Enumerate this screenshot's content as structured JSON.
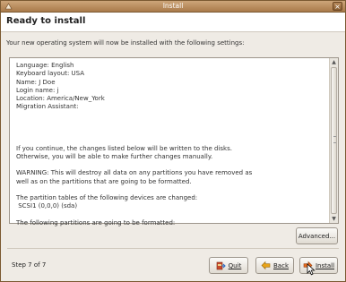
{
  "window": {
    "title": "Install"
  },
  "header": {
    "heading": "Ready to install"
  },
  "intro": "Your new operating system will now be installed with the following settings:",
  "settings_lines": [
    "Language: English",
    "Keyboard layout: USA",
    "Name: J Doe",
    "Login name: j",
    "Location: America/New_York",
    "Migration Assistant:"
  ],
  "notice_lines": [
    "If you continue, the changes listed below will be written to the disks.",
    "Otherwise, you will be able to make further changes manually."
  ],
  "warning_lines": [
    "WARNING: This will destroy all data on any partitions you have removed as",
    "well as on the partitions that are going to be formatted."
  ],
  "partition_lines": [
    "The partition tables of the following devices are changed:",
    " SCSI1 (0,0,0) (sda)"
  ],
  "format_line": "The following partitions are going to be formatted:",
  "buttons": {
    "advanced": "Advanced...",
    "quit": "Quit",
    "back": "Back",
    "install": "Install"
  },
  "footer": {
    "step": "Step 7 of 7"
  },
  "icons": {
    "app": "install-app-icon",
    "close": "close-icon",
    "quit": "quit-icon",
    "back": "back-arrow-icon",
    "install": "forward-arrow-icon",
    "cursor": "mouse-pointer-icon"
  },
  "colors": {
    "titlebar": "#a97a4a",
    "window_bg": "#efebe5",
    "back_arrow": "#e8a317",
    "install_arrow": "#e56b1f"
  }
}
